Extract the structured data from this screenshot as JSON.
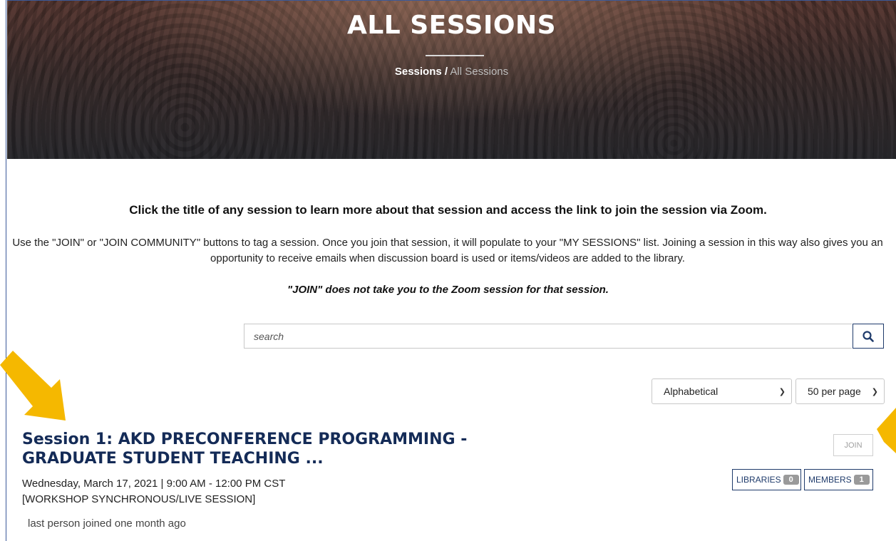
{
  "hero": {
    "title": "ALL SESSIONS",
    "breadcrumb": {
      "parent": "Sessions",
      "separator": "/",
      "current": "All Sessions"
    }
  },
  "intro": {
    "headline": "Click the title of any session to learn more about that session and access the link to join the session via Zoom.",
    "body": "Use the \"JOIN\" or \"JOIN COMMUNITY\" buttons to tag a session. Once you join that session, it will populate to your \"MY SESSIONS\" list. Joining a session in this way also gives you an opportunity to receive emails when discussion board is used or items/videos are added to the library.",
    "note": "\"JOIN\" does not take you to the Zoom session for that session."
  },
  "search": {
    "placeholder": "search",
    "value": "",
    "icon": "search-icon"
  },
  "filters": {
    "sort": {
      "selected": "Alphabetical",
      "icon": "chevron-down-icon"
    },
    "per_page": {
      "selected": "50 per page",
      "icon": "chevron-down-icon"
    }
  },
  "sessions": [
    {
      "title": "Session 1: AKD PRECONFERENCE PROGRAMMING - GRADUATE STUDENT TEACHING ...",
      "date": "Wednesday, March 17, 2021 | 9:00 AM - 12:00 PM CST",
      "type": "[WORKSHOP SYNCHRONOUS/LIVE SESSION]",
      "last_joined": "last person joined one month ago",
      "join_label": "JOIN",
      "libraries_label": "LIBRARIES",
      "libraries_count": "0",
      "members_label": "MEMBERS",
      "members_count": "1"
    }
  ],
  "annotations": {
    "arrow_color": "#f5b800",
    "icon": "arrow-icon"
  },
  "colors": {
    "accent": "#142b57",
    "button_border": "#1f3b6b",
    "badge": "#9a9a9a"
  }
}
